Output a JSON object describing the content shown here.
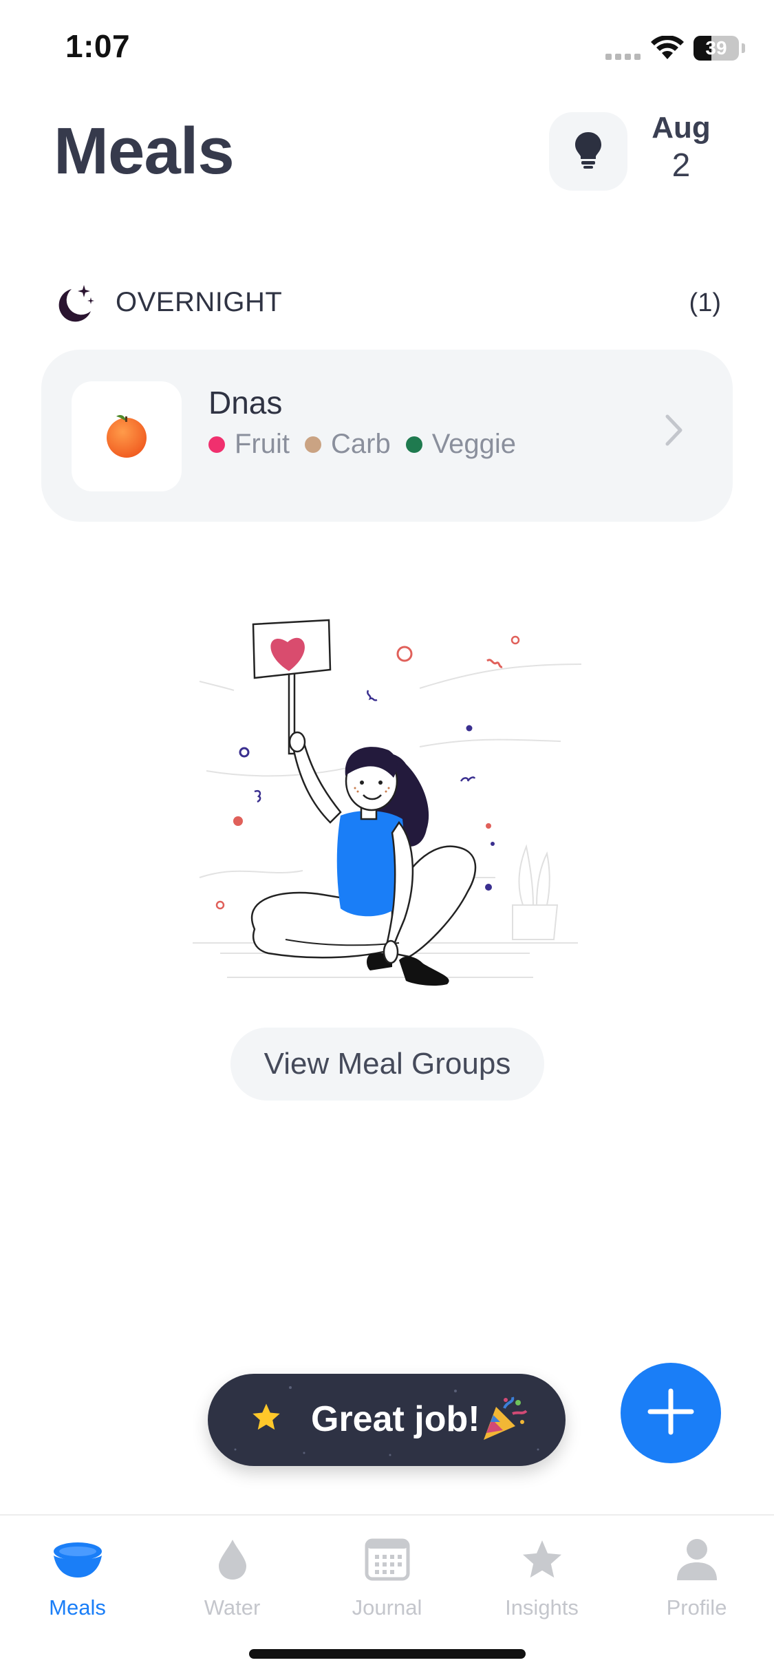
{
  "status_bar": {
    "time": "1:07",
    "battery": "39"
  },
  "header": {
    "title": "Meals",
    "date_month": "Aug",
    "date_day": "2"
  },
  "section": {
    "title": "OVERNIGHT",
    "count": "(1)"
  },
  "meal": {
    "name": "Dnas",
    "tags": [
      {
        "label": "Fruit",
        "color": "#f0306e"
      },
      {
        "label": "Carb",
        "color": "#caa383"
      },
      {
        "label": "Veggie",
        "color": "#1f7a4f"
      }
    ]
  },
  "view_groups_label": "View Meal Groups",
  "toast": {
    "text": "Great job!"
  },
  "tabs": [
    {
      "label": "Meals",
      "icon": "bowl-icon",
      "active": true
    },
    {
      "label": "Water",
      "icon": "water-drop-icon",
      "active": false
    },
    {
      "label": "Journal",
      "icon": "calendar-icon",
      "active": false
    },
    {
      "label": "Insights",
      "icon": "star-icon",
      "active": false
    },
    {
      "label": "Profile",
      "icon": "person-icon",
      "active": false
    }
  ],
  "colors": {
    "accent": "#1a7ef7",
    "toast_bg": "#2e3244",
    "card_bg": "#f3f5f7"
  }
}
